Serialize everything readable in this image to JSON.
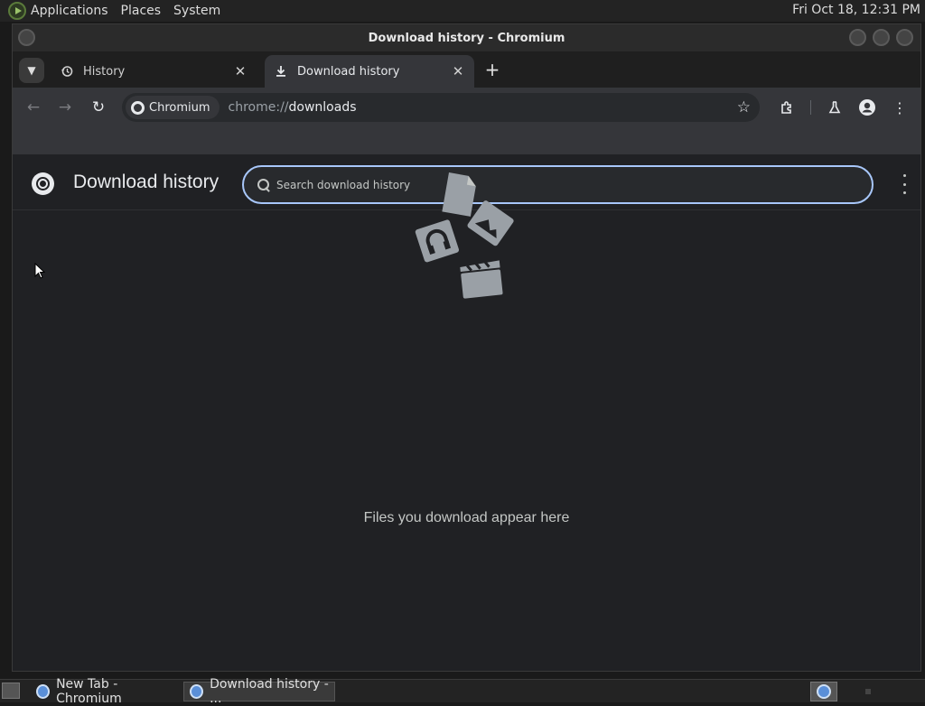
{
  "top_panel": {
    "menus": [
      "Applications",
      "Places",
      "System"
    ],
    "clock": "Fri Oct 18, 12:31 PM"
  },
  "window": {
    "title": "Download history - Chromium"
  },
  "tabs": [
    {
      "label": "History",
      "icon": "history-icon",
      "active": false
    },
    {
      "label": "Download history",
      "icon": "download-icon",
      "active": true
    }
  ],
  "toolbar": {
    "site_chip": "Chromium",
    "url_scheme": "chrome://",
    "url_host": "downloads"
  },
  "page": {
    "title": "Download history",
    "search_placeholder": "Search download history",
    "empty_message": "Files you download appear here"
  },
  "taskbar": {
    "tasks": [
      "New Tab - Chromium",
      "Download history - ..."
    ]
  }
}
